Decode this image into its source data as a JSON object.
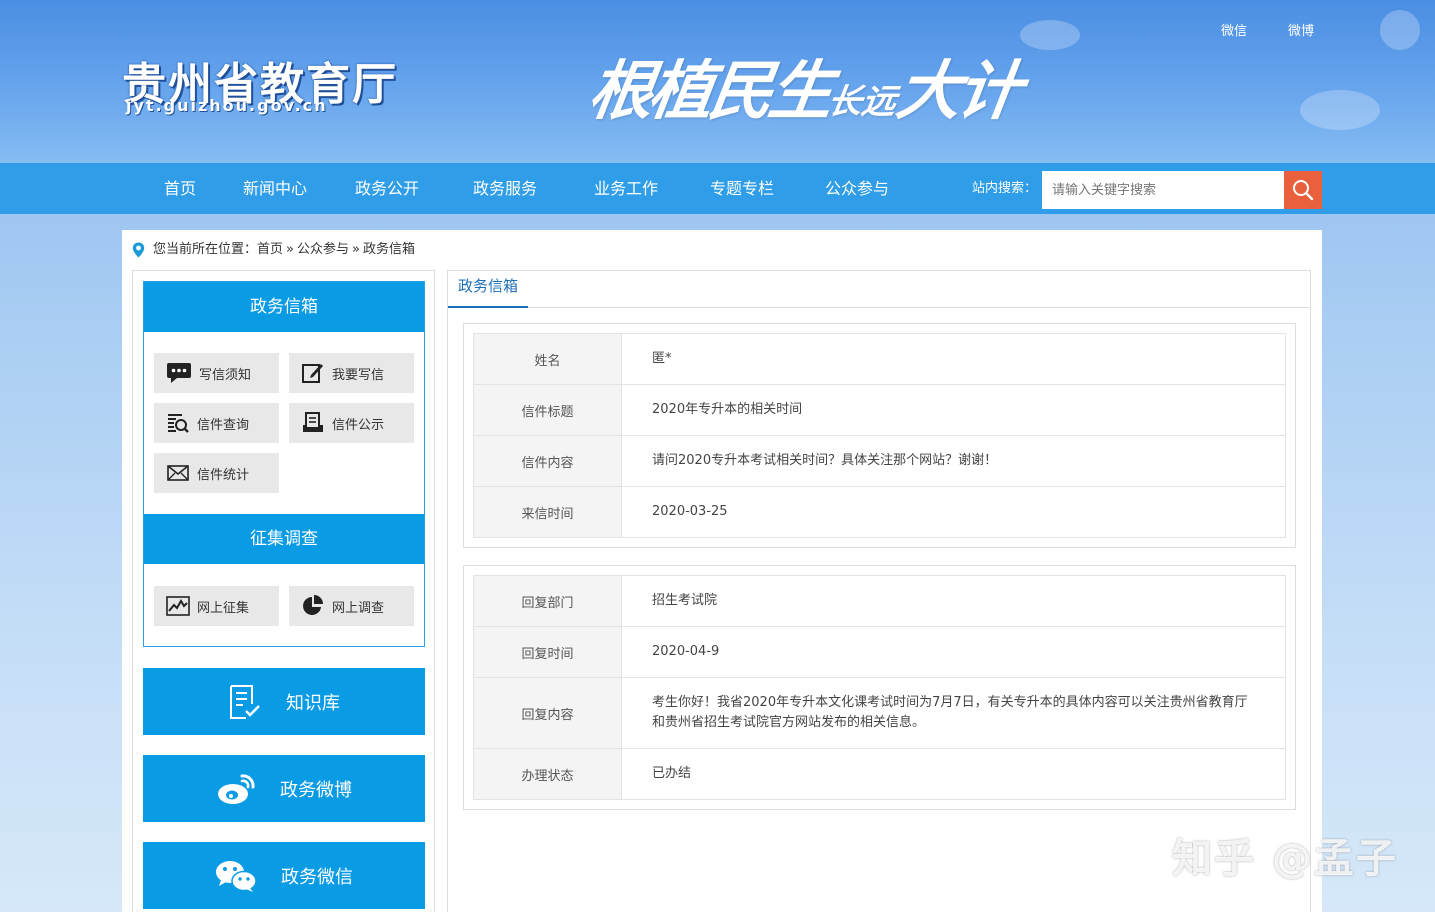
{
  "header": {
    "logo_cn": "贵州省教育厅",
    "logo_url": "jyt.guizhou.gov.cn",
    "slogan_main": "根植民生",
    "slogan_small": "长远",
    "slogan_end": "大计",
    "social": [
      "微信",
      "微博"
    ]
  },
  "nav": {
    "items": [
      "首页",
      "新闻中心",
      "政务公开",
      "政务服务",
      "业务工作",
      "专题专栏",
      "公众参与"
    ],
    "search_label": "站内搜索：",
    "search_placeholder": "请输入关键字搜索"
  },
  "breadcrumb": {
    "prefix": "您当前所在位置：",
    "items": [
      "首页",
      "公众参与",
      "政务信箱"
    ],
    "separator": "»"
  },
  "sidebar": {
    "mailbox_title": "政务信箱",
    "mailbox_buttons": [
      "写信须知",
      "我要写信",
      "信件查询",
      "信件公示",
      "信件统计"
    ],
    "survey_title": "征集调查",
    "survey_buttons": [
      "网上征集",
      "网上调查"
    ],
    "big_buttons": [
      "知识库",
      "政务微博",
      "政务微信"
    ]
  },
  "content": {
    "tab": "政务信箱",
    "letter": [
      {
        "label": "姓名",
        "value": "匿*"
      },
      {
        "label": "信件标题",
        "value": "2020年专升本的相关时间"
      },
      {
        "label": "信件内容",
        "value": "请问2020专升本考试相关时间？具体关注那个网站？谢谢！"
      },
      {
        "label": "来信时间",
        "value": "2020-03-25"
      }
    ],
    "reply": [
      {
        "label": "回复部门",
        "value": "招生考试院"
      },
      {
        "label": "回复时间",
        "value": "2020-04-9"
      },
      {
        "label": "回复内容",
        "value": "考生你好！我省2020年专升本文化课考试时间为7月7日，有关专升本的具体内容可以关注贵州省教育厅和贵州省招生考试院官方网站发布的相关信息。"
      },
      {
        "label": "办理状态",
        "value": "已办结"
      }
    ]
  },
  "watermark": "知乎 @孟子",
  "colors": {
    "nav": "#2f9de7",
    "sidebar_blue": "#0a9be5",
    "search_button": "#e8613c",
    "tab_text": "#1d6fb8"
  }
}
